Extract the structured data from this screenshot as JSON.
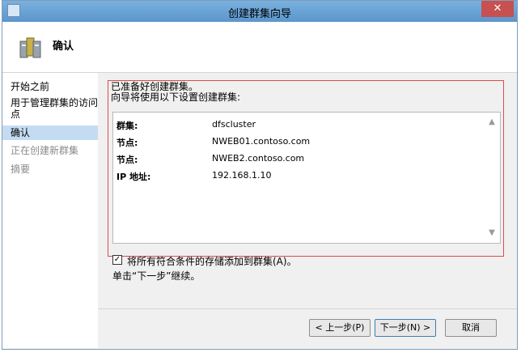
{
  "window": {
    "title": "创建群集向导",
    "close_glyph": "✕"
  },
  "header": {
    "title": "确认",
    "icon": "cluster-server-icon"
  },
  "sidebar": {
    "items": [
      {
        "label": "开始之前",
        "state": "done"
      },
      {
        "label": "用于管理群集的访问",
        "label2": "点",
        "state": "done"
      },
      {
        "label": "确认",
        "state": "active"
      },
      {
        "label": "正在创建新群集",
        "state": "disabled"
      },
      {
        "label": "摘要",
        "state": "disabled"
      }
    ]
  },
  "main": {
    "intro_line1": "已准备好创建群集。",
    "intro_line2": "向导将使用以下设置创建群集:",
    "summary": [
      {
        "key": "群集:",
        "value": "dfscluster"
      },
      {
        "key": "节点:",
        "value": "NWEB01.contoso.com"
      },
      {
        "key": "节点:",
        "value": "NWEB2.contoso.com"
      },
      {
        "key": "IP 地址:",
        "value": "192.168.1.10"
      }
    ],
    "add_storage_checkbox": {
      "checked": true,
      "label": "将所有符合条件的存储添加到群集(A)。"
    },
    "continue_text": "单击“下一步”继续。"
  },
  "buttons": {
    "prev": "< 上一步(P)",
    "next": "下一步(N) >",
    "cancel": "取消"
  },
  "colors": {
    "accent": "#5b95cc",
    "highlight_frame": "#e04b4b",
    "active_step": "#c4dcf2"
  }
}
